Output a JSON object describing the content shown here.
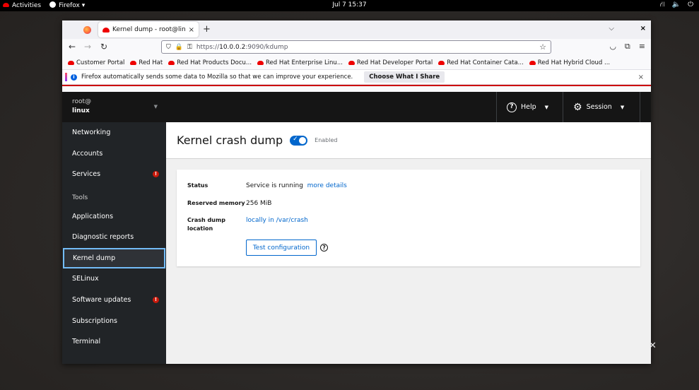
{
  "system_bar": {
    "activities": "Activities",
    "app_menu": "Firefox ▾",
    "clock": "Jul 7  15:37",
    "tray_icons": [
      "network-icon",
      "volume-icon",
      "power-icon"
    ]
  },
  "browser": {
    "tab_title": "Kernel dump - root@linux",
    "tab_close": "×",
    "new_tab": "+",
    "list_all_tabs": "⌵",
    "window_close": "×",
    "url_scheme": "https://",
    "url_host": "10.0.0.2",
    "url_path": ":9090/kdump",
    "bookmarks": [
      "Customer Portal",
      "Red Hat",
      "Red Hat Products Docu...",
      "Red Hat Enterprise Linu...",
      "Red Hat Developer Portal",
      "Red Hat Container Cata...",
      "Red Hat Hybrid Cloud ..."
    ],
    "notification": {
      "text": "Firefox automatically sends some data to Mozilla so that we can improve your experience.",
      "button": "Choose What I Share",
      "close": "×"
    }
  },
  "cockpit": {
    "host": {
      "user": "root@",
      "name": "linux"
    },
    "nav": {
      "networking": "Networking",
      "accounts": "Accounts",
      "services": "Services",
      "tools_header": "Tools",
      "applications": "Applications",
      "diagnostic_reports": "Diagnostic reports",
      "kernel_dump": "Kernel dump",
      "selinux": "SELinux",
      "software_updates": "Software updates",
      "subscriptions": "Subscriptions",
      "terminal": "Terminal"
    },
    "masthead": {
      "help": "Help",
      "session": "Session"
    },
    "page": {
      "title": "Kernel crash dump",
      "toggle_state": "Enabled",
      "status_label": "Status",
      "status_value": "Service is running",
      "status_link": "more details",
      "memory_label": "Reserved memory",
      "memory_value": "256 MiB",
      "location_label": "Crash dump location",
      "location_value": "locally in /var/crash",
      "test_button": "Test configuration"
    }
  },
  "colors": {
    "accent": "#0066cc",
    "sidebar_bg": "#212427",
    "masthead_bg": "#151515",
    "error": "#c9190b"
  }
}
